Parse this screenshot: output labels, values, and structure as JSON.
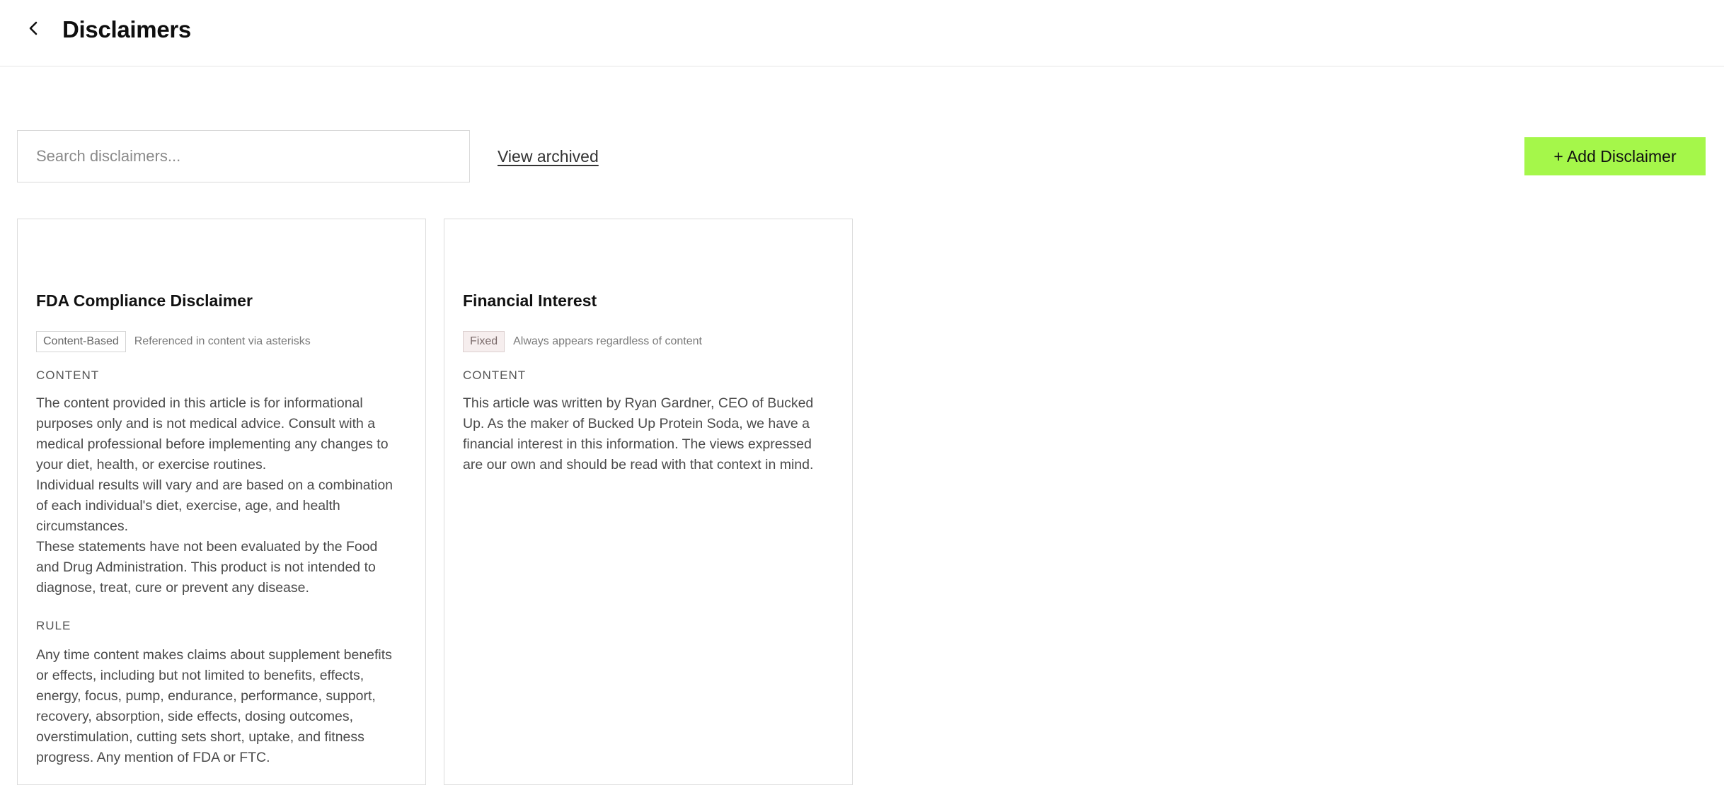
{
  "header": {
    "title": "Disclaimers",
    "back_icon": "chevron-left-icon"
  },
  "toolbar": {
    "search_placeholder": "Search disclaimers...",
    "search_value": "",
    "view_archived_label": "View archived",
    "add_button_label": "+ Add Disclaimer",
    "accent_color": "#a5f74a"
  },
  "disclaimers": [
    {
      "title": "FDA Compliance Disclaimer",
      "tag": "Content-Based",
      "tag_description": "Referenced in content via asterisks",
      "content_label": "CONTENT",
      "content_paragraphs": [
        "The content provided in this article is for informational purposes only and is not medical advice. Consult with a medical professional before implementing any changes to your diet, health, or exercise routines.",
        "Individual results will vary and are based on a combination of each individual's diet, exercise, age, and health circumstances.",
        "These statements have not been evaluated by the Food and Drug Administration. This product is not intended to diagnose, treat, cure or prevent any disease."
      ],
      "rule_label": "RULE",
      "rule_text": "Any time content makes claims about supplement benefits or effects, including but not limited to benefits, effects, energy, focus, pump, endurance, performance, support, recovery, absorption, side effects, dosing outcomes, overstimulation, cutting sets short, uptake, and fitness progress. Any mention of FDA or FTC."
    },
    {
      "title": "Financial Interest",
      "tag": "Fixed",
      "tag_description": "Always appears regardless of content",
      "content_label": "CONTENT",
      "content_paragraphs": [
        "This article was written by Ryan Gardner, CEO of Bucked Up. As the maker of Bucked Up Protein Soda, we have a financial interest in this information. The views expressed are our own and should be read with that context in mind."
      ]
    }
  ]
}
